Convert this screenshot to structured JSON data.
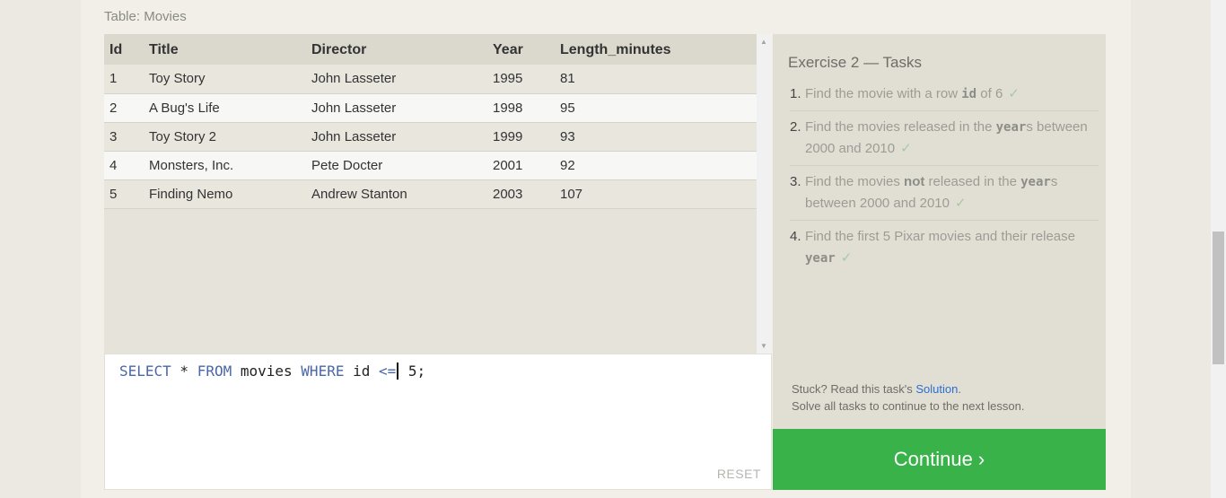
{
  "table": {
    "caption": "Table: Movies",
    "columns": [
      "Id",
      "Title",
      "Director",
      "Year",
      "Length_minutes"
    ],
    "rows": [
      [
        "1",
        "Toy Story",
        "John Lasseter",
        "1995",
        "81"
      ],
      [
        "2",
        "A Bug's Life",
        "John Lasseter",
        "1998",
        "95"
      ],
      [
        "3",
        "Toy Story 2",
        "John Lasseter",
        "1999",
        "93"
      ],
      [
        "4",
        "Monsters, Inc.",
        "Pete Docter",
        "2001",
        "92"
      ],
      [
        "5",
        "Finding Nemo",
        "Andrew Stanton",
        "2003",
        "107"
      ]
    ]
  },
  "editor": {
    "query_parts": {
      "k1": "SELECT",
      "t1": " * ",
      "k2": "FROM",
      "t2": " movies ",
      "k3": "WHERE",
      "t3": " id ",
      "op": "<=",
      "t4": " 5;"
    },
    "reset_label": "RESET"
  },
  "tasks": {
    "heading": "Exercise 2 — Tasks",
    "items": [
      {
        "num": "1.",
        "a": "Find the movie with a row ",
        "code": "id",
        "b": " of 6",
        "check": "✓"
      },
      {
        "num": "2.",
        "a": "Find the movies released in the ",
        "code": "year",
        "b": "s between 2000 and 2010",
        "check": "✓"
      },
      {
        "num": "3.",
        "a": "Find the movies ",
        "bold": "not",
        "a2": " released in the ",
        "code": "year",
        "b": "s between 2000 and 2010",
        "check": "✓"
      },
      {
        "num": "4.",
        "a": "Find the first 5 Pixar movies and their release ",
        "code": "year",
        "b": "",
        "check": "✓"
      }
    ],
    "stuck_prefix": "Stuck? Read this task's ",
    "solution_link": "Solution",
    "stuck_suffix": ".",
    "hint_line": "Solve all tasks to continue to the next lesson."
  },
  "continue_label": "Continue ›",
  "colors": {
    "continue_bg": "#38b249",
    "keyword": "#4a67a8",
    "link": "#2b6ed2"
  }
}
